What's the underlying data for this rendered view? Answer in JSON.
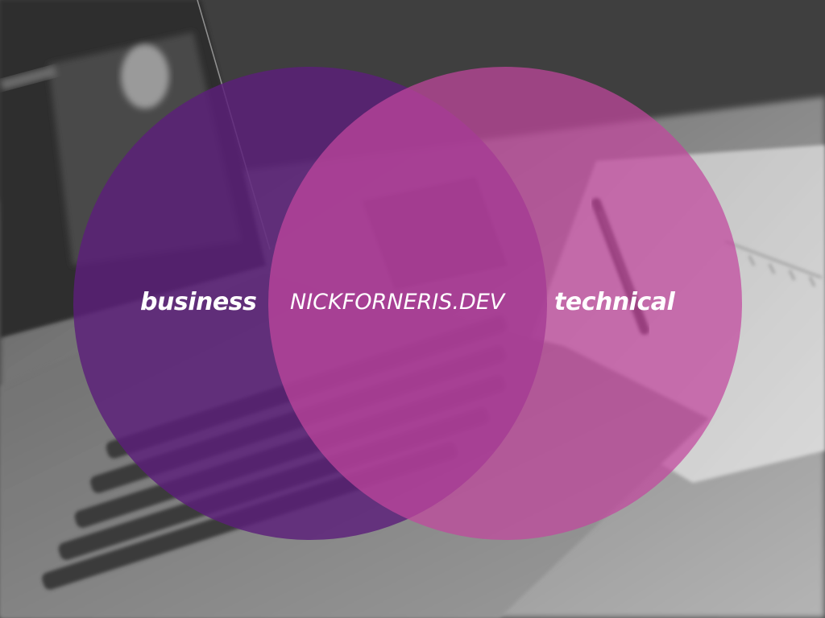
{
  "venn": {
    "left_label": "business",
    "center_label": "NICKFORNERIS.DEV",
    "right_label": "technical"
  },
  "colors": {
    "background": "#3e3e3e",
    "left_circle": "#5c1f7a",
    "right_circle": "#c2479e",
    "text": "#ffffff"
  },
  "background_photo": {
    "subject": "grayscale laptop keyboard and pen on desk"
  }
}
